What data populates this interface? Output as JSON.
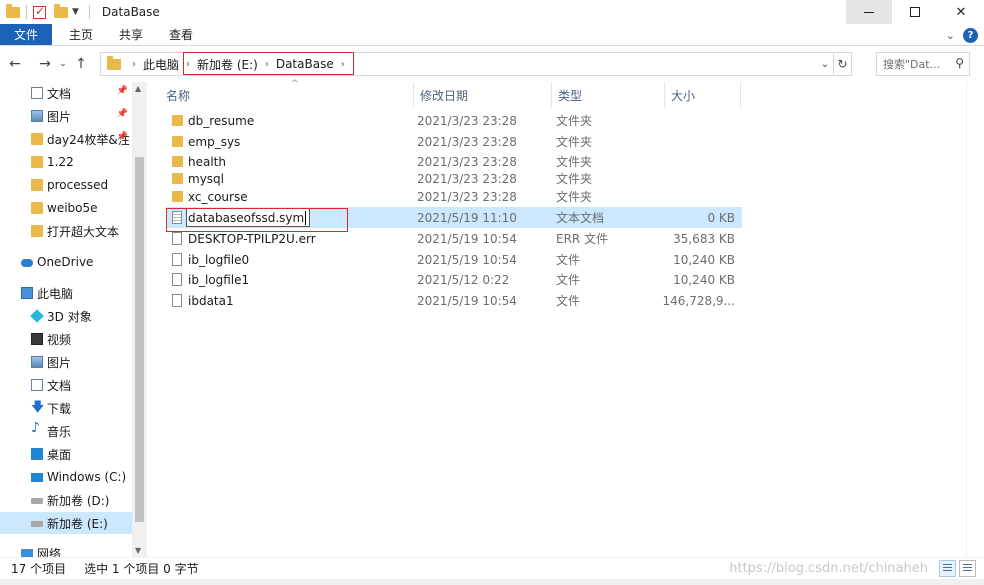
{
  "window": {
    "title": "DataBase"
  },
  "ribbon": {
    "tabs": [
      "文件",
      "主页",
      "共享",
      "查看"
    ]
  },
  "address": {
    "crumbs": [
      "此电脑",
      "新加卷 (E:)",
      "DataBase"
    ],
    "search_placeholder": "搜索\"Dat..."
  },
  "sidebar": {
    "items": [
      {
        "label": "文档",
        "icon": "document-icon",
        "pinned": true
      },
      {
        "label": "图片",
        "icon": "picture-icon",
        "pinned": true
      },
      {
        "label": "day24枚举&注",
        "icon": "folder-icon",
        "pinned": true
      },
      {
        "label": "1.22",
        "icon": "folder-icon",
        "pinned": false
      },
      {
        "label": "processed",
        "icon": "folder-icon",
        "pinned": false
      },
      {
        "label": "weibo5e",
        "icon": "folder-icon",
        "pinned": false
      },
      {
        "label": "打开超大文本",
        "icon": "folder-icon",
        "pinned": false
      },
      {
        "label": "OneDrive",
        "icon": "cloud-icon",
        "pinned": false
      },
      {
        "label": "此电脑",
        "icon": "computer-icon",
        "pinned": false
      },
      {
        "label": "3D 对象",
        "icon": "3d-objects-icon",
        "pinned": false
      },
      {
        "label": "视频",
        "icon": "video-icon",
        "pinned": false
      },
      {
        "label": "图片",
        "icon": "picture-icon",
        "pinned": false
      },
      {
        "label": "文档",
        "icon": "document-icon",
        "pinned": false
      },
      {
        "label": "下载",
        "icon": "download-icon",
        "pinned": false
      },
      {
        "label": "音乐",
        "icon": "music-icon",
        "pinned": false
      },
      {
        "label": "桌面",
        "icon": "desktop-icon",
        "pinned": false
      },
      {
        "label": "Windows (C:)",
        "icon": "windows-drive-icon",
        "pinned": false
      },
      {
        "label": "新加卷 (D:)",
        "icon": "drive-icon",
        "pinned": false
      },
      {
        "label": "新加卷 (E:)",
        "icon": "drive-icon",
        "pinned": false,
        "selected": true
      },
      {
        "label": "网络",
        "icon": "network-icon",
        "pinned": false
      }
    ]
  },
  "columns": {
    "name": "名称",
    "date": "修改日期",
    "type": "类型",
    "size": "大小"
  },
  "files": [
    {
      "name": "db_resume",
      "date": "2021/3/23 23:28",
      "type": "文件夹",
      "size": "",
      "kind": "folder"
    },
    {
      "name": "emp_sys",
      "date": "2021/3/23 23:28",
      "type": "文件夹",
      "size": "",
      "kind": "folder"
    },
    {
      "name": "health",
      "date": "2021/3/23 23:28",
      "type": "文件夹",
      "size": "",
      "kind": "folder"
    },
    {
      "name": "mysql",
      "date": "2021/3/23 23:28",
      "type": "文件夹",
      "size": "",
      "kind": "folder"
    },
    {
      "name": "xc_course",
      "date": "2021/3/23 23:28",
      "type": "文件夹",
      "size": "",
      "kind": "folder"
    },
    {
      "name": "databaseofssd.sym",
      "date": "2021/5/19 11:10",
      "type": "文本文档",
      "size": "0 KB",
      "kind": "text",
      "renaming": true
    },
    {
      "name": "DESKTOP-TPILP2U.err",
      "date": "2021/5/19 10:54",
      "type": "ERR 文件",
      "size": "35,683 KB",
      "kind": "file"
    },
    {
      "name": "ib_logfile0",
      "date": "2021/5/19 10:54",
      "type": "文件",
      "size": "10,240 KB",
      "kind": "file"
    },
    {
      "name": "ib_logfile1",
      "date": "2021/5/12 0:22",
      "type": "文件",
      "size": "10,240 KB",
      "kind": "file"
    },
    {
      "name": "ibdata1",
      "date": "2021/5/19 10:54",
      "type": "文件",
      "size": "146,728,9...",
      "kind": "file"
    }
  ],
  "status": {
    "count": "17 个项目",
    "selection": "选中 1 个项目 0 字节",
    "watermark": "https://blog.csdn.net/chinaheh"
  },
  "colors": {
    "accent": "#1c62b9",
    "selection": "#cce8ff",
    "highlight": "#d6282e",
    "folder": "#e9b949"
  }
}
